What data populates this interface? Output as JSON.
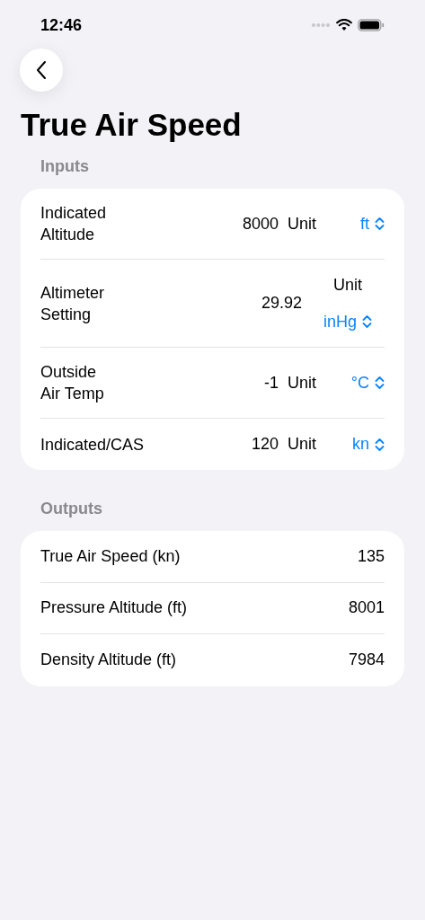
{
  "status_bar": {
    "time": "12:46"
  },
  "title": "True Air Speed",
  "inputs": {
    "header": "Inputs",
    "rows": [
      {
        "kind": "inline",
        "label_lines": [
          "Indicated",
          "Altitude"
        ],
        "value": "8000",
        "unit_label": "Unit",
        "unit": "ft"
      },
      {
        "kind": "stacked",
        "label_lines": [
          "Altimeter",
          "Setting"
        ],
        "value": "29.92",
        "unit_label": "Unit",
        "unit": "inHg"
      },
      {
        "kind": "inline",
        "label_lines": [
          "Outside",
          "Air Temp"
        ],
        "value": "-1",
        "unit_label": "Unit",
        "unit": "°C"
      },
      {
        "kind": "inline",
        "label_lines": [
          "Indicated/CAS"
        ],
        "value": "120",
        "unit_label": "Unit",
        "unit": "kn"
      }
    ]
  },
  "outputs": {
    "header": "Outputs",
    "rows": [
      {
        "label": "True Air Speed (kn)",
        "value": "135"
      },
      {
        "label": "Pressure Altitude (ft)",
        "value": "8001"
      },
      {
        "label": "Density Altitude (ft)",
        "value": "7984"
      }
    ]
  }
}
